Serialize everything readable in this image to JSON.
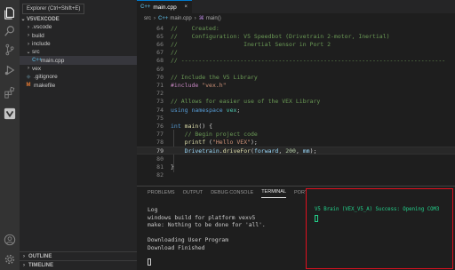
{
  "explorer": {
    "tooltip": "Explorer (Ctrl+Shift+E)",
    "root": "V5VEXCODE",
    "items": [
      {
        "label": ".vscode",
        "chevron": "›"
      },
      {
        "label": "build",
        "chevron": "›"
      },
      {
        "label": "include",
        "chevron": "›"
      },
      {
        "label": "src",
        "chevron": "⌄"
      },
      {
        "label": "main.cpp",
        "icon": "C++"
      },
      {
        "label": "vex",
        "chevron": "›"
      },
      {
        "label": ".gitignore",
        "icon": "◆"
      },
      {
        "label": "makefile",
        "icon": "M"
      }
    ],
    "outline": "OUTLINE",
    "timeline": "TIMELINE"
  },
  "tab": {
    "label": "main.cpp",
    "icon": "C++",
    "close": "×"
  },
  "breadcrumb": {
    "folder": "src",
    "sep": "›",
    "file": "main.cpp",
    "icon": "C++",
    "symbol": "main()",
    "symbol_icon": "⌘"
  },
  "code": {
    "lines": [
      {
        "n": "64",
        "parts": [
          [
            "c-comment",
            "//    Created:"
          ]
        ]
      },
      {
        "n": "65",
        "parts": [
          [
            "c-comment",
            "//    Configuration: V5 Speedbot (Drivetrain 2-motor, Inertial)"
          ]
        ]
      },
      {
        "n": "66",
        "parts": [
          [
            "c-comment",
            "//                   Inertial Sensor in Port 2"
          ]
        ]
      },
      {
        "n": "67",
        "parts": [
          [
            "c-comment",
            "//"
          ]
        ]
      },
      {
        "n": "68",
        "parts": [
          [
            "c-comment",
            "// ----------------------------------------------------------------------------"
          ]
        ]
      },
      {
        "n": "69",
        "parts": []
      },
      {
        "n": "70",
        "parts": [
          [
            "c-comment",
            "// Include the V5 Library"
          ]
        ]
      },
      {
        "n": "71",
        "parts": [
          [
            "c-ctrl",
            "#include"
          ],
          [
            "c-plain",
            " "
          ],
          [
            "c-str",
            "\"vex.h\""
          ]
        ]
      },
      {
        "n": "72",
        "parts": []
      },
      {
        "n": "73",
        "parts": [
          [
            "c-comment",
            "// Allows for easier use of the VEX Library"
          ]
        ]
      },
      {
        "n": "74",
        "parts": [
          [
            "c-kw",
            "using"
          ],
          [
            "c-plain",
            " "
          ],
          [
            "c-kw",
            "namespace"
          ],
          [
            "c-plain",
            " "
          ],
          [
            "c-type",
            "vex"
          ],
          [
            "c-plain",
            ";"
          ]
        ]
      },
      {
        "n": "75",
        "parts": []
      },
      {
        "n": "76",
        "parts": [
          [
            "c-kw",
            "int"
          ],
          [
            "c-plain",
            " "
          ],
          [
            "c-fn",
            "main"
          ],
          [
            "c-plain",
            "() {"
          ]
        ]
      },
      {
        "n": "77",
        "parts": [
          [
            "c-plain",
            "    "
          ],
          [
            "c-comment",
            "// Begin project code"
          ]
        ]
      },
      {
        "n": "78",
        "parts": [
          [
            "c-plain",
            "    "
          ],
          [
            "c-fn",
            "printf"
          ],
          [
            "c-plain",
            " ("
          ],
          [
            "c-str",
            "\"Hello VEX\""
          ],
          [
            "c-plain",
            ");"
          ]
        ]
      },
      {
        "n": "79",
        "parts": [
          [
            "c-plain",
            "    "
          ],
          [
            "c-var",
            "Drivetrain"
          ],
          [
            "c-plain",
            "."
          ],
          [
            "c-fn",
            "driveFor"
          ],
          [
            "c-plain",
            "("
          ],
          [
            "c-var",
            "forward"
          ],
          [
            "c-plain",
            ", "
          ],
          [
            "c-num",
            "200"
          ],
          [
            "c-plain",
            ", "
          ],
          [
            "c-var",
            "mm"
          ],
          [
            "c-plain",
            ");"
          ]
        ]
      },
      {
        "n": "80",
        "parts": []
      },
      {
        "n": "81",
        "parts": [
          [
            "c-plain",
            "}"
          ]
        ]
      },
      {
        "n": "82",
        "parts": []
      }
    ]
  },
  "panel": {
    "tabs": [
      "PROBLEMS",
      "OUTPUT",
      "DEBUG CONSOLE",
      "TERMINAL",
      "PORTS"
    ],
    "terminal_left": [
      "Log",
      "windows build for platform vexv5",
      "make: Nothing to be done for 'all'.",
      "",
      "Downloading User Program",
      "Download Finished"
    ],
    "terminal_right": "V5 Brain (VEX_V5_A) Success: Opening COM3"
  },
  "colors": {
    "accent": "#007acc",
    "highlight_border": "#e0101f",
    "success_text": "#23d18b"
  }
}
